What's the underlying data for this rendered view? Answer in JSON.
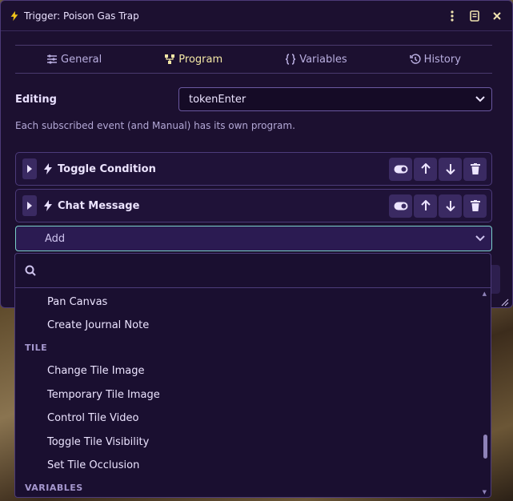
{
  "window": {
    "title": "Trigger: Poison Gas Trap"
  },
  "tabs": [
    {
      "label": "General",
      "icon": "sliders-icon"
    },
    {
      "label": "Program",
      "icon": "sitemap-icon"
    },
    {
      "label": "Variables",
      "icon": "braces-icon"
    },
    {
      "label": "History",
      "icon": "history-icon"
    }
  ],
  "active_tab": "Program",
  "editing": {
    "label": "Editing",
    "selected": "tokenEnter"
  },
  "hint": "Each subscribed event (and Manual) has its own program.",
  "program_items": [
    {
      "label": "Toggle Condition"
    },
    {
      "label": "Chat Message"
    }
  ],
  "add_select": {
    "label": "Add"
  },
  "dropdown": {
    "search_placeholder": "",
    "entries": [
      {
        "type": "option",
        "label": "Pan Canvas"
      },
      {
        "type": "option",
        "label": "Create Journal Note"
      },
      {
        "type": "group",
        "label": "TILE"
      },
      {
        "type": "option",
        "label": "Change Tile Image"
      },
      {
        "type": "option",
        "label": "Temporary Tile Image"
      },
      {
        "type": "option",
        "label": "Control Tile Video"
      },
      {
        "type": "option",
        "label": "Toggle Tile Visibility"
      },
      {
        "type": "option",
        "label": "Set Tile Occlusion"
      },
      {
        "type": "group",
        "label": "VARIABLES"
      }
    ]
  },
  "colors": {
    "accent": "#f0c419",
    "active_tab": "#f4e8a6",
    "add_border": "#7ad0c9",
    "panel_bg": "#1c1030"
  }
}
